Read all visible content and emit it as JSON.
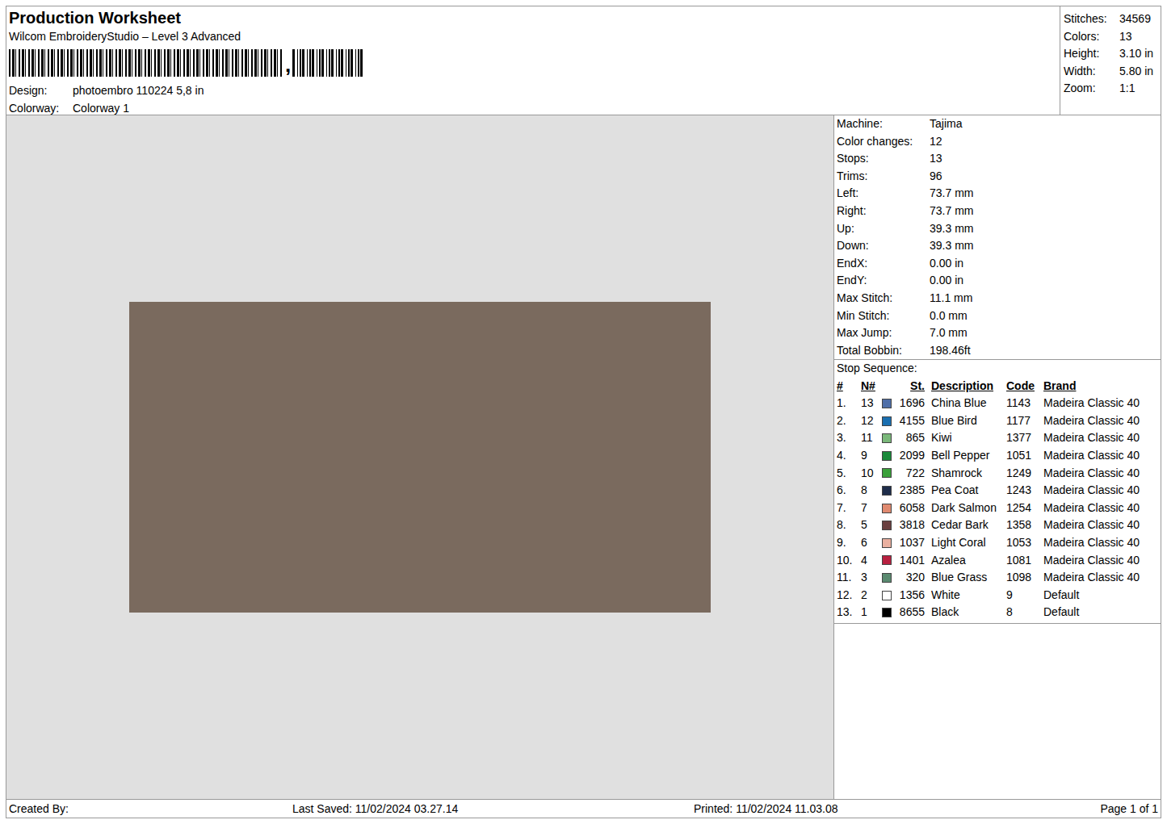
{
  "title": "Production Worksheet",
  "software": "Wilcom EmbroideryStudio – Level 3 Advanced",
  "barcode": {
    "separator": ","
  },
  "fields": [
    {
      "label": "Design:",
      "value": "photoembro 110224 5,8 in"
    },
    {
      "label": "Colorway:",
      "value": "Colorway 1"
    }
  ],
  "summary": [
    {
      "label": "Stitches:",
      "value": "34569"
    },
    {
      "label": "Colors:",
      "value": "13"
    },
    {
      "label": "Height:",
      "value": "3.10 in"
    },
    {
      "label": "Width:",
      "value": "5.80 in"
    },
    {
      "label": "Zoom:",
      "value": "1:1"
    }
  ],
  "machine": [
    {
      "label": "Machine:",
      "value": "Tajima"
    },
    {
      "label": "Color changes:",
      "value": "12"
    },
    {
      "label": "Stops:",
      "value": "13"
    },
    {
      "label": "Trims:",
      "value": "96"
    },
    {
      "label": "Left:",
      "value": "73.7 mm"
    },
    {
      "label": "Right:",
      "value": "73.7 mm"
    },
    {
      "label": "Up:",
      "value": "39.3 mm"
    },
    {
      "label": "Down:",
      "value": "39.3 mm"
    },
    {
      "label": "EndX:",
      "value": "0.00 in"
    },
    {
      "label": "EndY:",
      "value": "0.00 in"
    },
    {
      "label": "Max Stitch:",
      "value": "11.1 mm"
    },
    {
      "label": "Min Stitch:",
      "value": "0.0 mm"
    },
    {
      "label": "Max Jump:",
      "value": "7.0 mm"
    },
    {
      "label": "Total Bobbin:",
      "value": "198.46ft"
    }
  ],
  "stop_sequence": {
    "title": "Stop Sequence:",
    "columns": [
      "#",
      "N#",
      "St.",
      "Description",
      "Code",
      "Brand"
    ],
    "rows": [
      {
        "num": "1.",
        "n": "13",
        "stitches": "1696",
        "description": "China Blue",
        "code": "1143",
        "brand": "Madeira Classic 40",
        "color": "#4f6fa8"
      },
      {
        "num": "2.",
        "n": "12",
        "stitches": "4155",
        "description": "Blue Bird",
        "code": "1177",
        "brand": "Madeira Classic 40",
        "color": "#1a6fb0"
      },
      {
        "num": "3.",
        "n": "11",
        "stitches": "865",
        "description": "Kiwi",
        "code": "1377",
        "brand": "Madeira Classic 40",
        "color": "#7ab87a"
      },
      {
        "num": "4.",
        "n": "9",
        "stitches": "2099",
        "description": "Bell Pepper",
        "code": "1051",
        "brand": "Madeira Classic 40",
        "color": "#1a8a3a"
      },
      {
        "num": "5.",
        "n": "10",
        "stitches": "722",
        "description": "Shamrock",
        "code": "1249",
        "brand": "Madeira Classic 40",
        "color": "#3aa03a"
      },
      {
        "num": "6.",
        "n": "8",
        "stitches": "2385",
        "description": "Pea Coat",
        "code": "1243",
        "brand": "Madeira Classic 40",
        "color": "#1e2d4a"
      },
      {
        "num": "7.",
        "n": "7",
        "stitches": "6058",
        "description": "Dark Salmon",
        "code": "1254",
        "brand": "Madeira Classic 40",
        "color": "#e08a70"
      },
      {
        "num": "8.",
        "n": "5",
        "stitches": "3818",
        "description": "Cedar Bark",
        "code": "1358",
        "brand": "Madeira Classic 40",
        "color": "#6a4040"
      },
      {
        "num": "9.",
        "n": "6",
        "stitches": "1037",
        "description": "Light Coral",
        "code": "1053",
        "brand": "Madeira Classic 40",
        "color": "#eab0a0"
      },
      {
        "num": "10.",
        "n": "4",
        "stitches": "1401",
        "description": "Azalea",
        "code": "1081",
        "brand": "Madeira Classic 40",
        "color": "#b82040"
      },
      {
        "num": "11.",
        "n": "3",
        "stitches": "320",
        "description": "Blue Grass",
        "code": "1098",
        "brand": "Madeira Classic 40",
        "color": "#5a8a70"
      },
      {
        "num": "12.",
        "n": "2",
        "stitches": "1356",
        "description": "White",
        "code": "9",
        "brand": "Default",
        "color": "#ffffff"
      },
      {
        "num": "13.",
        "n": "1",
        "stitches": "8655",
        "description": "Black",
        "code": "8",
        "brand": "Default",
        "color": "#000000"
      }
    ]
  },
  "footer": {
    "created_by": "Created By:",
    "last_saved": "Last Saved:  11/02/2024 03.27.14",
    "printed": "Printed:  11/02/2024 11.03.08",
    "page": "Page 1 of 1"
  }
}
